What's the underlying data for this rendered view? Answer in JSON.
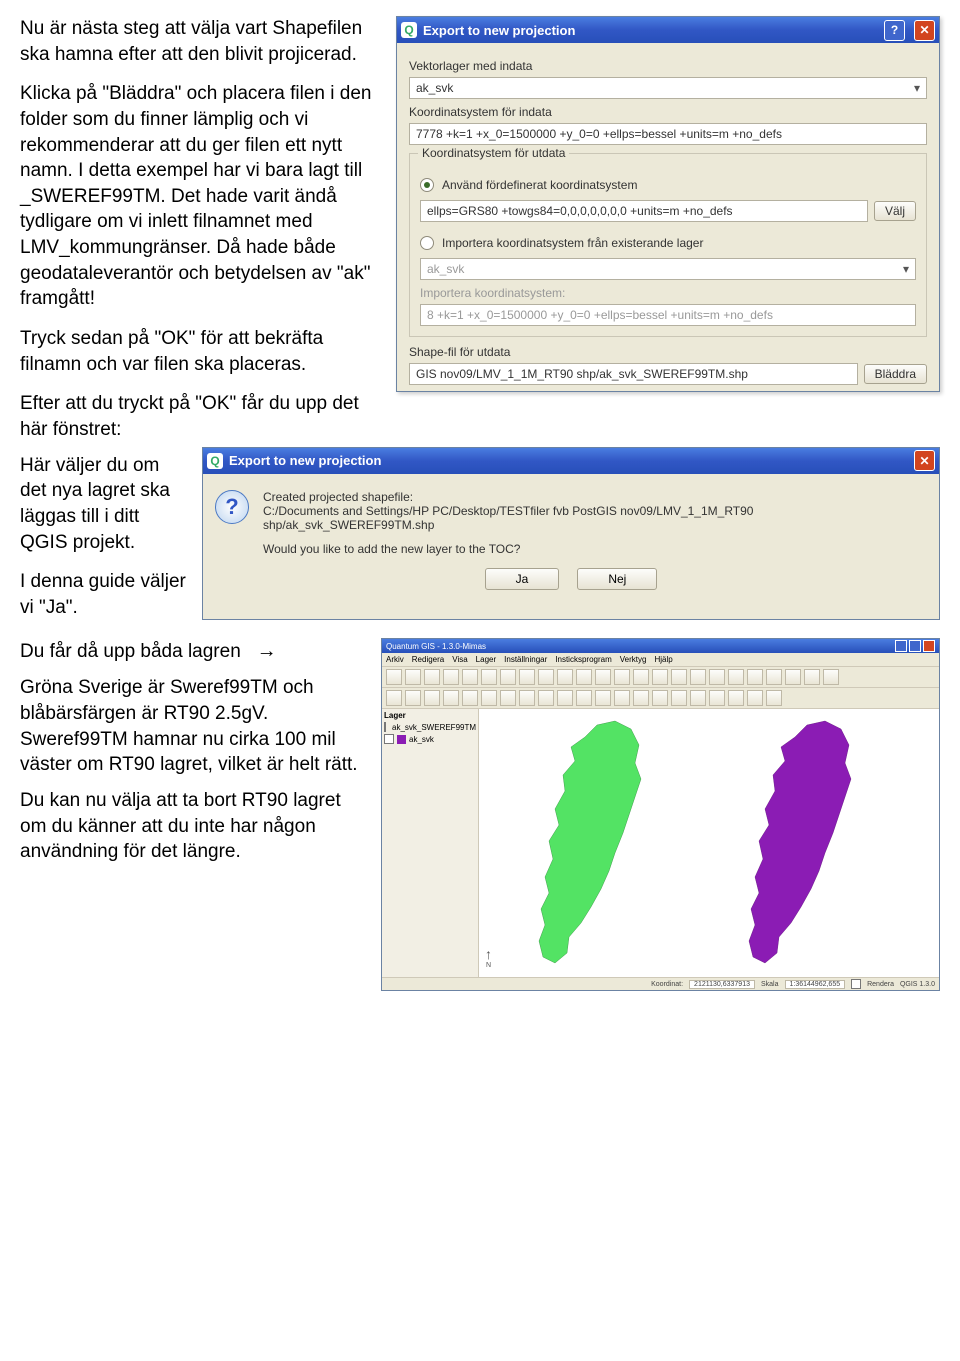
{
  "body_text": {
    "p1": "Nu är nästa steg att välja vart Shapefilen ska hamna efter att den blivit projicerad.",
    "p2": "Klicka på \"Bläddra\" och placera filen i den folder som du finner lämplig och vi rekommenderar att du ger filen ett nytt namn. I detta exempel har vi bara lagt till _SWEREF99TM. Det hade varit ändå tydligare om vi inlett filnamnet med LMV_kommungränser. Då hade både geodataleverantör och betydelsen av \"ak\" framgått!",
    "p3": "Tryck sedan på \"OK\"  för att bekräfta filnamn och var filen ska placeras.",
    "p4": "Efter att du tryckt på \"OK\" får du upp det här fönstret:",
    "p5": "Här väljer du om det nya lagret ska läggas till i ditt QGIS projekt.",
    "p6": "I denna guide väljer vi \"Ja\".",
    "lower1": "Du får då upp båda lagren",
    "lower2": "Gröna Sverige är Sweref99TM och blåbärsfärgen är RT90 2.5gV. Sweref99TM hamnar nu cirka 100 mil väster om RT90 lagret, vilket är helt rätt.",
    "lower3": "Du kan nu välja att ta bort RT90 lagret om du känner att du inte har någon användning för det längre.",
    "arrow": "→"
  },
  "dialog1": {
    "title": "Export to new projection",
    "label_vector": "Vektorlager med indata",
    "vector_value": "ak_svk",
    "label_srs_in": "Koordinatsystem för indata",
    "srs_in_value": "7778 +k=1 +x_0=1500000 +y_0=0 +ellps=bessel +units=m +no_defs",
    "fs_out_label": "Koordinatsystem för utdata",
    "radio_predef": "Använd fördefinerat koordinatsystem",
    "srs_out_value": "ellps=GRS80 +towgs84=0,0,0,0,0,0,0 +units=m +no_defs",
    "btn_valj": "Välj",
    "radio_import": "Importera koordinatsystem från existerande lager",
    "import_layer_value": "ak_svk",
    "label_import_srs": "Importera koordinatsystem:",
    "import_srs_value": "8 +k=1 +x_0=1500000 +y_0=0 +ellps=bessel +units=m +no_defs",
    "label_output": "Shape-fil för utdata",
    "output_value": "GIS nov09/LMV_1_1M_RT90 shp/ak_svk_SWEREF99TM.shp",
    "btn_browse": "Bläddra"
  },
  "dialog2": {
    "title": "Export to new projection",
    "msg1": "Created projected shapefile:",
    "msg2": "C:/Documents and Settings/HP PC/Desktop/TESTfiler fvb PostGIS nov09/LMV_1_1M_RT90 shp/ak_svk_SWEREF99TM.shp",
    "msg3": "Would you like to add the new layer to the TOC?",
    "btn_yes": "Ja",
    "btn_no": "Nej"
  },
  "qgis": {
    "title": "Quantum GIS - 1.3.0-Mimas",
    "menus": [
      "Arkiv",
      "Redigera",
      "Visa",
      "Lager",
      "Inställningar",
      "Insticksprogram",
      "Verktyg",
      "Hjälp"
    ],
    "layers_header": "Lager",
    "layer1": "ak_svk_SWEREF99TM",
    "layer2": "ak_svk",
    "status_coord_label": "Koordinat:",
    "status_coord": "2121130,6337913",
    "status_scale_label": "Skala",
    "status_scale": "1:36144962,655",
    "status_render": "Rendera",
    "brand": "QGIS 1.3.0"
  },
  "colors": {
    "green": "#53e364",
    "purple": "#8b1cb4"
  }
}
